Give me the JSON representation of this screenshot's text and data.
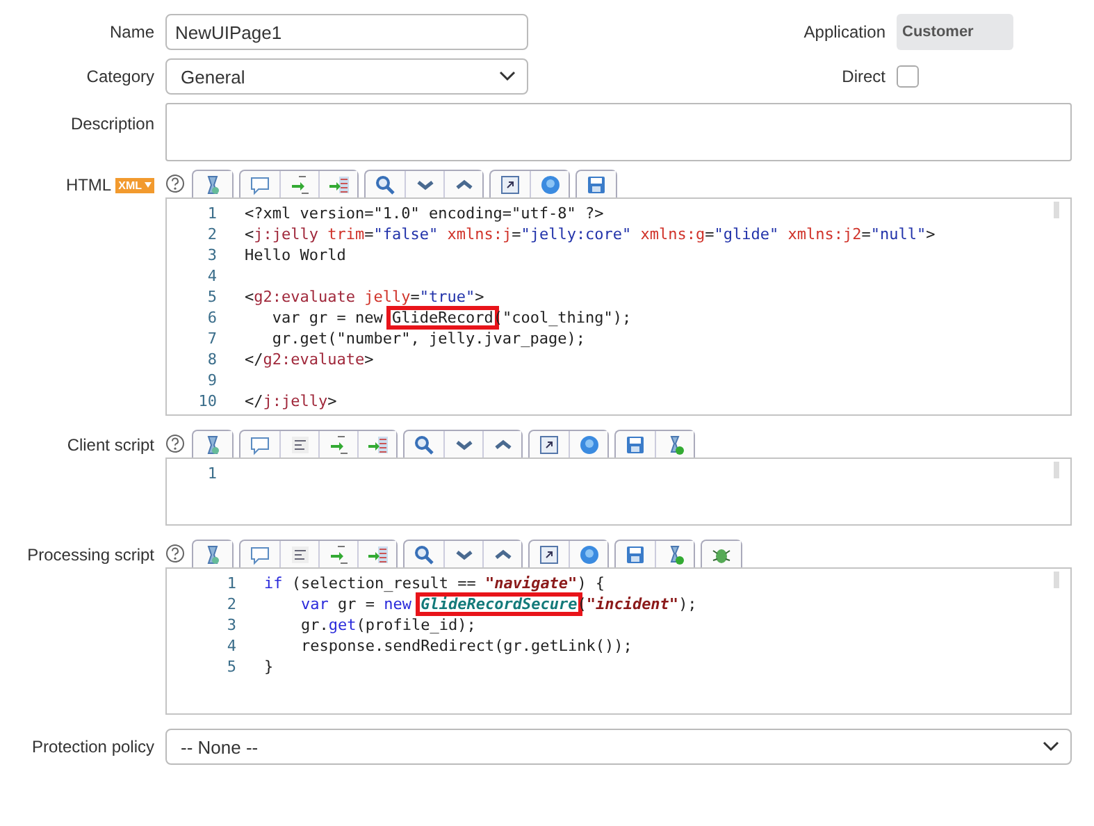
{
  "name_field": {
    "label": "Name",
    "value": "NewUIPage1"
  },
  "application": {
    "label": "Application",
    "value": "Customer"
  },
  "category": {
    "label": "Category",
    "value": "General"
  },
  "direct": {
    "label": "Direct",
    "checked": false
  },
  "description": {
    "label": "Description"
  },
  "editors": [
    {
      "label": "HTML",
      "badge": "XML",
      "lines": [
        {
          "num": "1",
          "tokens": [
            {
              "t": "<?xml version=\"1.0\" encoding=\"utf-8\" ?>",
              "kind": "plain"
            }
          ]
        },
        {
          "num": "2",
          "tokens": [
            {
              "t": "<",
              "kind": "plain"
            },
            {
              "t": "j:jelly",
              "kind": "tag"
            },
            {
              "t": " trim",
              "kind": "attr"
            },
            {
              "t": "=",
              "kind": "plain"
            },
            {
              "t": "\"false\"",
              "kind": "string"
            },
            {
              "t": " xmlns:j",
              "kind": "attr"
            },
            {
              "t": "=",
              "kind": "plain"
            },
            {
              "t": "\"jelly:core\"",
              "kind": "string"
            },
            {
              "t": " xmlns:g",
              "kind": "attr"
            },
            {
              "t": "=",
              "kind": "plain"
            },
            {
              "t": "\"glide\"",
              "kind": "string"
            },
            {
              "t": " xmlns:j2",
              "kind": "attr"
            },
            {
              "t": "=",
              "kind": "plain"
            },
            {
              "t": "\"null\"",
              "kind": "string"
            },
            {
              "t": ">",
              "kind": "plain"
            }
          ]
        },
        {
          "num": "3",
          "tokens": [
            {
              "t": "Hello World",
              "kind": "plain"
            }
          ]
        },
        {
          "num": "4"
        },
        {
          "num": "5",
          "tokens": [
            {
              "t": "<",
              "kind": "plain"
            },
            {
              "t": "g2:evaluate",
              "kind": "tag"
            },
            {
              "t": " jelly",
              "kind": "attr"
            },
            {
              "t": "=",
              "kind": "plain"
            },
            {
              "t": "\"true\"",
              "kind": "string"
            },
            {
              "t": ">",
              "kind": "plain"
            }
          ]
        },
        {
          "num": "6",
          "tokens": [
            {
              "t": "   var gr = new ",
              "kind": "plain"
            },
            {
              "t": "GlideRecord",
              "kind": "plain",
              "highlight": true
            },
            {
              "t": "(\"cool_thing\");",
              "kind": "plain"
            }
          ]
        },
        {
          "num": "7",
          "tokens": [
            {
              "t": "   gr.get(\"number\", jelly.jvar_page);",
              "kind": "plain"
            }
          ]
        },
        {
          "num": "8",
          "tokens": [
            {
              "t": "</",
              "kind": "plain"
            },
            {
              "t": "g2:evaluate",
              "kind": "tag"
            },
            {
              "t": ">",
              "kind": "plain"
            }
          ]
        },
        {
          "num": "9"
        },
        {
          "num": "10",
          "tokens": [
            {
              "t": "</",
              "kind": "plain"
            },
            {
              "t": "j:jelly",
              "kind": "tag"
            },
            {
              "t": ">",
              "kind": "plain"
            }
          ]
        }
      ]
    },
    {
      "label": "Client script",
      "lines": [
        {
          "num": "1"
        }
      ]
    },
    {
      "label": "Processing script",
      "lines": [
        {
          "num": "1",
          "tokens": [
            {
              "t": "if",
              "kind": "keyword"
            },
            {
              "t": " (selection_result == ",
              "kind": "plain"
            },
            {
              "t": "\"navigate\"",
              "kind": "literal"
            },
            {
              "t": ") {",
              "kind": "plain"
            }
          ]
        },
        {
          "num": "2",
          "tokens": [
            {
              "t": "    var",
              "kind": "keyword"
            },
            {
              "t": " gr = ",
              "kind": "plain"
            },
            {
              "t": "new ",
              "kind": "keyword"
            },
            {
              "t": "GlideRecordSecure",
              "kind": "class",
              "highlight": true
            },
            {
              "t": "(",
              "kind": "plain"
            },
            {
              "t": "\"incident\"",
              "kind": "literal"
            },
            {
              "t": ");",
              "kind": "plain"
            }
          ]
        },
        {
          "num": "3",
          "tokens": [
            {
              "t": "    gr.",
              "kind": "plain"
            },
            {
              "t": "get",
              "kind": "keyword"
            },
            {
              "t": "(profile_id);",
              "kind": "plain"
            }
          ]
        },
        {
          "num": "4",
          "tokens": [
            {
              "t": "    response.sendRedirect(gr.getLink());",
              "kind": "plain"
            }
          ]
        },
        {
          "num": "5",
          "tokens": [
            {
              "t": "}",
              "kind": "plain"
            }
          ]
        }
      ]
    }
  ],
  "protection": {
    "label": "Protection policy",
    "value": "-- None --"
  }
}
